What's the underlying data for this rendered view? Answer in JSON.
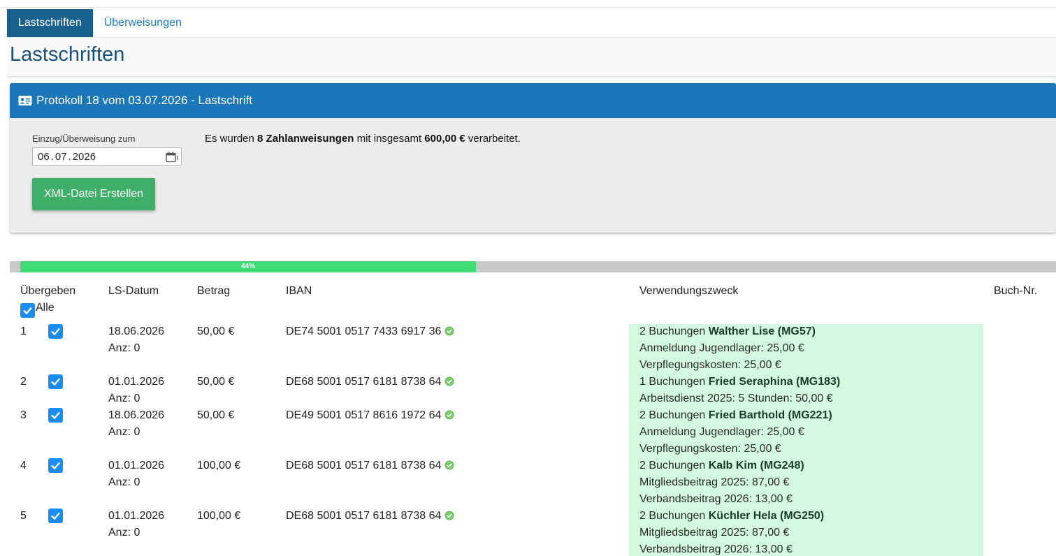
{
  "tabs": [
    {
      "label": "Lastschriften",
      "active": true
    },
    {
      "label": "Überweisungen",
      "active": false
    }
  ],
  "page_title": "Lastschriften",
  "panel": {
    "title": "Protokoll 18 vom 03.07.2026 - Lastschrift",
    "icon": "id-card-icon",
    "date_label": "Einzug/Überweisung zum",
    "date_day": "06",
    "date_month": "07",
    "date_year": "2026",
    "button_label": "XML-Datei Erstellen",
    "summary_prefix": "Es wurden ",
    "summary_count": "8 Zahlanweisungen",
    "summary_mid": " mit insgesamt ",
    "summary_total": "600,00 €",
    "summary_suffix": " verarbeitet."
  },
  "progress": {
    "label": "44%",
    "value": 0.44
  },
  "table": {
    "headers": {
      "transferred": "Übergeben",
      "date": "LS-Datum",
      "amount": "Betrag",
      "iban": "IBAN",
      "purpose": "Verwendungszweck",
      "booking_no": "Buch-Nr."
    },
    "select_all_label": "Alle",
    "rows": [
      {
        "num": "1",
        "checked": true,
        "date": "18.06.2026",
        "anz": "Anz: 0",
        "amount": "50,00 €",
        "iban": "DE74 5001 0517 7433 6917 36",
        "purpose_prefix": "2 Buchungen ",
        "purpose_name": "Walther Lise (MG57)",
        "purpose_lines": [
          "Anmeldung Jugendlager: 25,00 €",
          "Verpflegungskosten: 25,00 €"
        ]
      },
      {
        "num": "2",
        "checked": true,
        "date": "01.01.2026",
        "anz": "Anz: 0",
        "amount": "50,00 €",
        "iban": "DE68 5001 0517 6181 8738 64",
        "purpose_prefix": "1 Buchungen ",
        "purpose_name": "Fried Seraphina (MG183)",
        "purpose_lines": [
          "Arbeitsdienst 2025: 5 Stunden: 50,00 €"
        ]
      },
      {
        "num": "3",
        "checked": true,
        "date": "18.06.2026",
        "anz": "Anz: 0",
        "amount": "50,00 €",
        "iban": "DE49 5001 0517 8616 1972 64",
        "purpose_prefix": "2 Buchungen ",
        "purpose_name": "Fried Barthold (MG221)",
        "purpose_lines": [
          "Anmeldung Jugendlager: 25,00 €",
          "Verpflegungskosten: 25,00 €"
        ]
      },
      {
        "num": "4",
        "checked": true,
        "date": "01.01.2026",
        "anz": "Anz: 0",
        "amount": "100,00 €",
        "iban": "DE68 5001 0517 6181 8738 64",
        "purpose_prefix": "2 Buchungen ",
        "purpose_name": "Kalb Kim (MG248)",
        "purpose_lines": [
          "Mitgliedsbeitrag 2025: 87,00 €",
          "Verbandsbeitrag 2026: 13,00 €"
        ]
      },
      {
        "num": "5",
        "checked": true,
        "date": "01.01.2026",
        "anz": "Anz: 0",
        "amount": "100,00 €",
        "iban": "DE68 5001 0517 6181 8738 64",
        "purpose_prefix": "2 Buchungen ",
        "purpose_name": "Küchler Hela (MG250)",
        "purpose_lines": [
          "Mitgliedsbeitrag 2025: 87,00 €",
          "Verbandsbeitrag 2026: 13,00 €"
        ]
      }
    ]
  },
  "colors": {
    "tab_active": "#18618e",
    "panel_header": "#1a78b9",
    "button": "#3fae68",
    "progress_fill": "#3edc74",
    "checkbox": "#1a8cf5",
    "purpose_bg": "#d3fadf"
  }
}
